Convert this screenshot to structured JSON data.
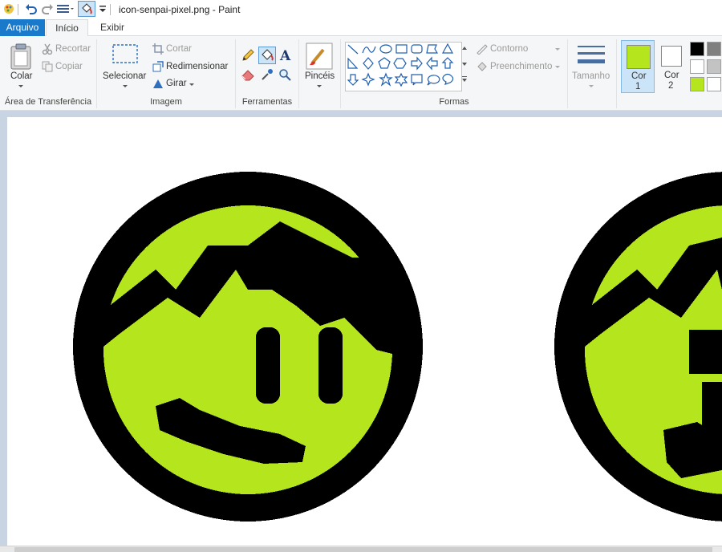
{
  "window": {
    "title": "icon-senpai-pixel.png - Paint"
  },
  "tabs": {
    "file": "Arquivo",
    "home": "Início",
    "view": "Exibir"
  },
  "clipboard": {
    "paste": "Colar",
    "cut": "Recortar",
    "copy": "Copiar",
    "group": "Área de Transferência"
  },
  "image": {
    "select": "Selecionar",
    "crop": "Cortar",
    "resize": "Redimensionar",
    "rotate": "Girar",
    "group": "Imagem"
  },
  "tools": {
    "group": "Ferramentas"
  },
  "brushes": {
    "label": "Pincéis"
  },
  "shapes": {
    "outline": "Contorno",
    "fill": "Preenchimento",
    "group": "Formas"
  },
  "size": {
    "label": "Tamanho"
  },
  "colors": {
    "color1_line1": "Cor",
    "color1_line2": "1",
    "color2_line1": "Cor",
    "color2_line2": "2",
    "color1_value": "#b5e61d",
    "color2_value": "#ffffff",
    "palette": [
      "#000000",
      "#7f7f7f",
      "#ffffff",
      "#c3c3c3",
      "#b5e61d",
      "#ffffff"
    ]
  },
  "artwork": {
    "lime": "#b5e61d",
    "outline": "#000000"
  }
}
